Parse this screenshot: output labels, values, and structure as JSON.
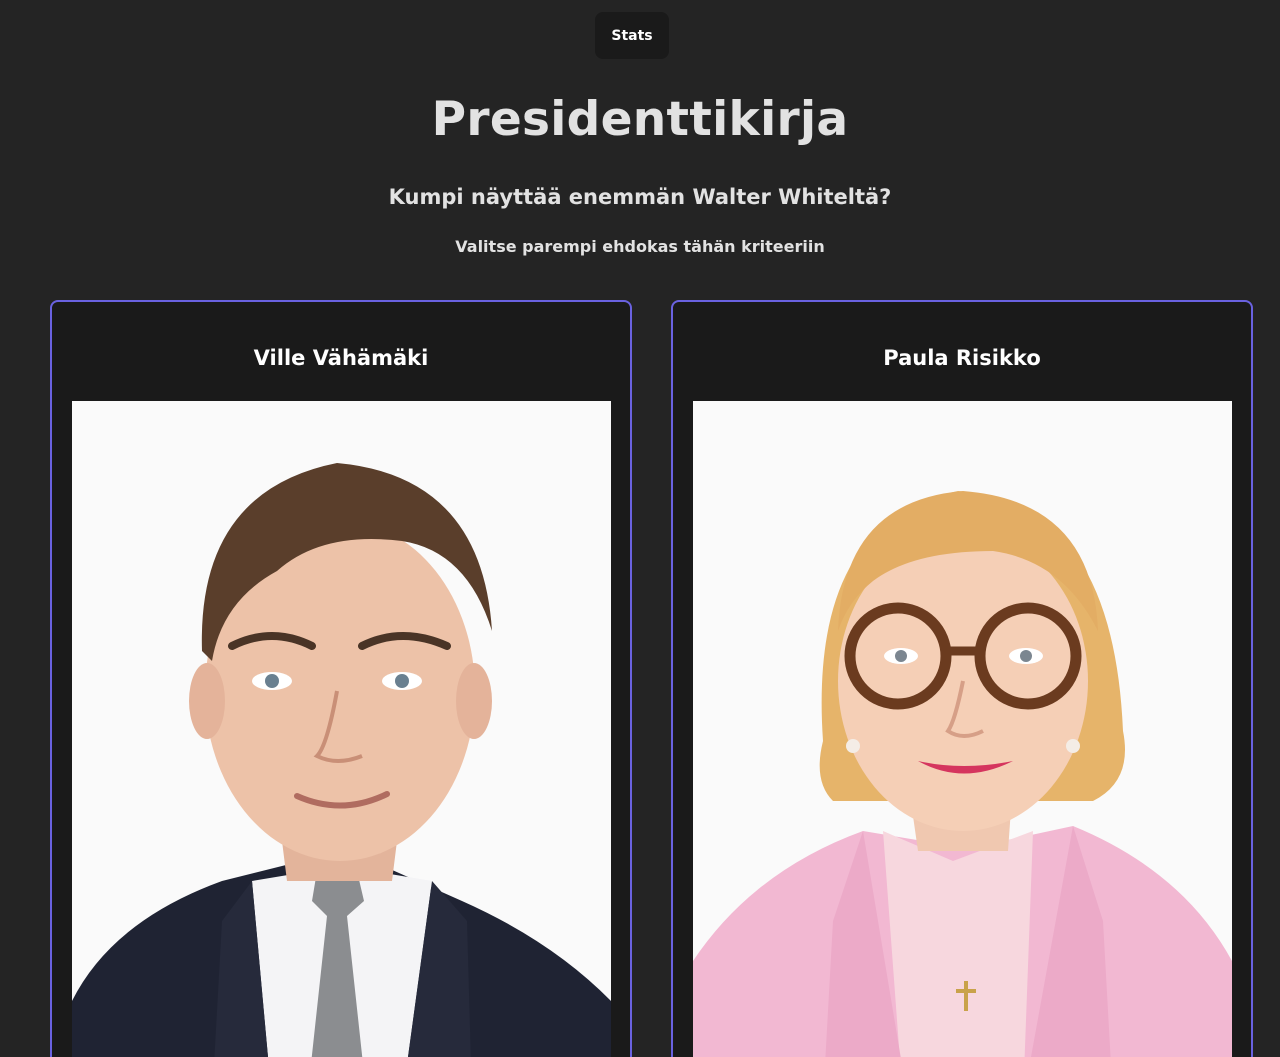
{
  "header": {
    "stats_label": "Stats"
  },
  "main": {
    "title": "Presidenttikirja",
    "question": "Kumpi näyttää enemmän Walter Whiteltä?",
    "instruction": "Valitse parempi ehdokas tähän kriteeriin"
  },
  "candidates": [
    {
      "name": "Ville Vähämäki"
    },
    {
      "name": "Paula Risikko"
    }
  ],
  "colors": {
    "background": "#242424",
    "card_background": "#1a1a1a",
    "card_border": "#6a62e0",
    "text": "#e2e2e2"
  }
}
